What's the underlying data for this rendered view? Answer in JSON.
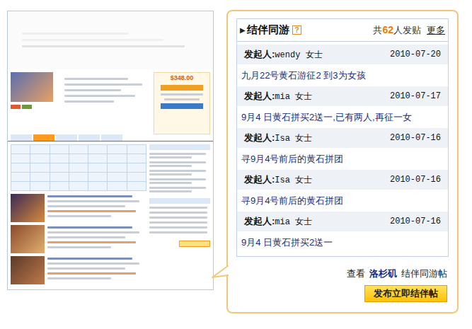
{
  "panel": {
    "marker": "▶",
    "title": "结伴同游",
    "help": "?",
    "count_prefix": "共",
    "count": "62",
    "count_suffix": "人发贴",
    "more": "更多"
  },
  "posts": [
    {
      "author_label": "发起人:",
      "author": "wendy 女士",
      "date": "2010-07-20",
      "title": "九月22号黄石游征2 到3为女孩"
    },
    {
      "author_label": "发起人:",
      "author": "mia 女士",
      "date": "2010-07-17",
      "title": "9月4 日黄石拼买2送一,已有两人,再征一女"
    },
    {
      "author_label": "发起人:",
      "author": "Isa 女士",
      "date": "2010-07-16",
      "title": "寻9月4号前后的黄石拼团"
    },
    {
      "author_label": "发起人:",
      "author": "Isa 女士",
      "date": "2010-07-16",
      "title": "寻9月4号前后的黄石拼团"
    },
    {
      "author_label": "发起人:",
      "author": "mia 女士",
      "date": "2010-07-16",
      "title": "9月4 日黄石拼买2送一"
    }
  ],
  "footer": {
    "prefix": "查看",
    "city": "洛杉矶",
    "suffix": "结伴同游帖",
    "button": "发布立即结伴帖"
  },
  "thumbnail": {
    "price": "$348.00"
  }
}
